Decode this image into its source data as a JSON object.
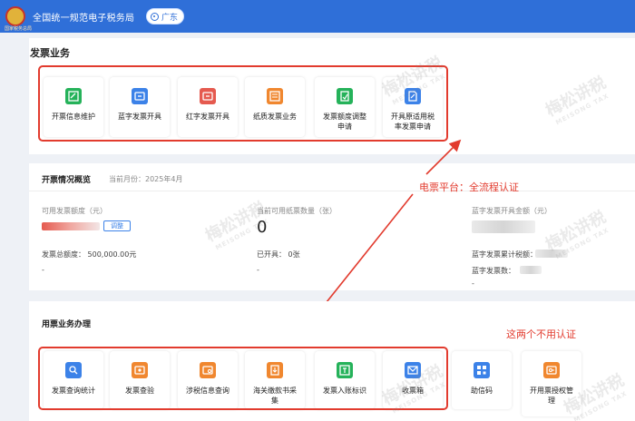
{
  "header": {
    "emblem_caption": "国家税务总局",
    "title": "全国统一规范电子税务局",
    "region": "广东"
  },
  "invoice_business": {
    "title": "发票业务",
    "tiles": [
      {
        "label": "开票信息维护",
        "icon": "edit-doc-icon",
        "color": "#25b25a"
      },
      {
        "label": "蓝字发票开具",
        "icon": "invoice-blue-icon",
        "color": "#3c82e8"
      },
      {
        "label": "红字发票开具",
        "icon": "invoice-red-icon",
        "color": "#e55a4f"
      },
      {
        "label": "纸质发票业务",
        "icon": "paper-invoice-icon",
        "color": "#f0872f"
      },
      {
        "label": "发票额度调整申请",
        "icon": "quota-adjust-icon",
        "color": "#25b25a"
      },
      {
        "label": "开具原适用税率发票申请",
        "icon": "tax-rate-doc-icon",
        "color": "#3c82e8"
      }
    ]
  },
  "overview": {
    "title": "开票情况概览",
    "month": "当前月份：2025年4月",
    "available_amount_label": "可用发票额度（元）",
    "adjust_button": "调整",
    "total_quota": "发票总额度：  500,000.00元",
    "dash1": "-",
    "available_count_label": "当前可用纸票数量（张）",
    "available_count": "0",
    "issued_label": "已开具：   0张",
    "dash2": "-",
    "blue_total_label": "蓝字发票开具金额（元）",
    "blue_cumulative_label": "蓝字发票累计税额：",
    "blue_count_label": "蓝字发票数：",
    "dash3": "-"
  },
  "ticket_business": {
    "title": "用票业务办理",
    "tiles": [
      {
        "label": "发票查询统计",
        "icon": "search-doc-icon",
        "color": "#3c82e8"
      },
      {
        "label": "发票查验",
        "icon": "verify-icon",
        "color": "#f0872f"
      },
      {
        "label": "涉税信息查询",
        "icon": "tax-info-icon",
        "color": "#f0872f"
      },
      {
        "label": "海关缴款书采集",
        "icon": "customs-doc-icon",
        "color": "#f0872f"
      },
      {
        "label": "发票入账标识",
        "icon": "account-mark-icon",
        "color": "#25b25a"
      },
      {
        "label": "收票箱",
        "icon": "mailbox-icon",
        "color": "#3c82e8"
      },
      {
        "label": "助信码",
        "icon": "qr-code-icon",
        "color": "#3c82e8"
      },
      {
        "label": "开用票授权管理",
        "icon": "authorization-icon",
        "color": "#f0872f"
      }
    ]
  },
  "annotations": {
    "full_auth": "电票平台：全流程认证",
    "no_auth": "这两个不用认证"
  },
  "watermark": {
    "text": "梅松讲税",
    "sub": "MEISONG TAX"
  }
}
